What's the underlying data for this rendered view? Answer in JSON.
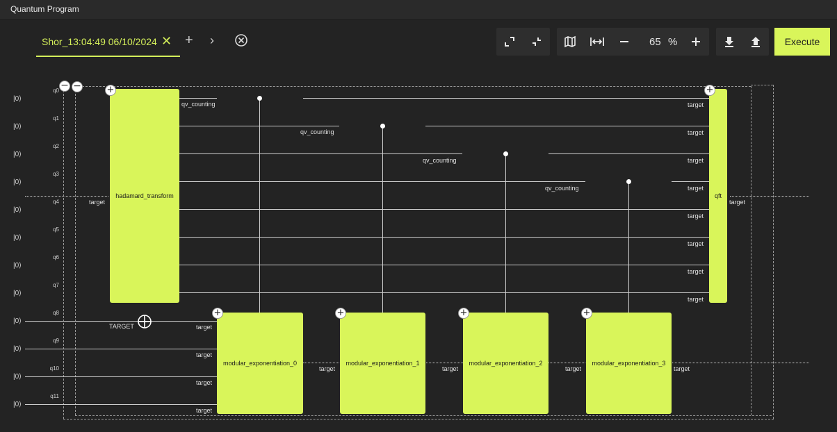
{
  "window": {
    "title": "Quantum Program"
  },
  "tab": {
    "label": "Shor_13:04:49 06/10/2024"
  },
  "toolbar": {
    "zoom_value": "65",
    "zoom_unit": "%",
    "execute_label": "Execute"
  },
  "colors": {
    "accent": "#d9f55a",
    "background": "#232323"
  },
  "qubits": [
    {
      "ket": "|0⟩",
      "label": "q0"
    },
    {
      "ket": "|0⟩",
      "label": "q1"
    },
    {
      "ket": "|0⟩",
      "label": "q2"
    },
    {
      "ket": "|0⟩",
      "label": "q3"
    },
    {
      "ket": "|0⟩",
      "label": "q4"
    },
    {
      "ket": "|0⟩",
      "label": "q5"
    },
    {
      "ket": "|0⟩",
      "label": "q6"
    },
    {
      "ket": "|0⟩",
      "label": "q7"
    },
    {
      "ket": "|0⟩",
      "label": "q8"
    },
    {
      "ket": "|0⟩",
      "label": "q9"
    },
    {
      "ket": "|0⟩",
      "label": "q10"
    },
    {
      "ket": "|0⟩",
      "label": "q11"
    }
  ],
  "gates": {
    "hadamard": {
      "name": "hadamard_transform",
      "port": "target"
    },
    "qft": {
      "name": "qft",
      "port": "target"
    },
    "modexp": [
      {
        "name": "modular_exponentiation_0"
      },
      {
        "name": "modular_exponentiation_1"
      },
      {
        "name": "modular_exponentiation_2"
      },
      {
        "name": "modular_exponentiation_3"
      }
    ]
  },
  "labels": {
    "qv_counting": "qv_counting",
    "target": "target",
    "target_upper": "TARGET"
  }
}
